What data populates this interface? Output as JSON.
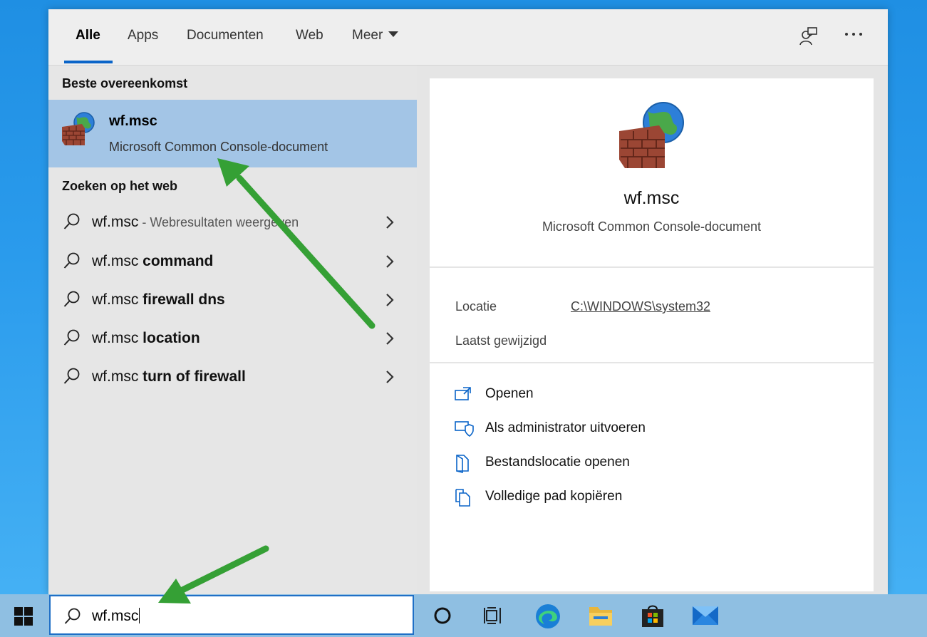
{
  "tabs": [
    {
      "label": "Alle",
      "active": true
    },
    {
      "label": "Apps"
    },
    {
      "label": "Documenten"
    },
    {
      "label": "Web"
    },
    {
      "label": "Meer"
    }
  ],
  "toolbar_icons": [
    "feedback-icon",
    "more-options-icon"
  ],
  "left": {
    "best_match_title": "Beste overeenkomst",
    "best_match": {
      "name": "wf.msc",
      "type": "Microsoft Common Console-document",
      "icon": "firewall-globe-icon"
    },
    "web_title": "Zoeken op het web",
    "web_results": [
      {
        "prefix": "wf.msc",
        "suffix": "",
        "note": " - Webresultaten weergeven"
      },
      {
        "prefix": "wf.msc ",
        "suffix": "command",
        "note": ""
      },
      {
        "prefix": "wf.msc ",
        "suffix": "firewall dns",
        "note": ""
      },
      {
        "prefix": "wf.msc ",
        "suffix": "location",
        "note": ""
      },
      {
        "prefix": "wf.msc ",
        "suffix": "turn of firewall",
        "note": ""
      }
    ]
  },
  "detail": {
    "name": "wf.msc",
    "type": "Microsoft Common Console-document",
    "location_label": "Locatie",
    "location_value": "C:\\WINDOWS\\system32",
    "modified_label": "Laatst gewijzigd",
    "actions": [
      {
        "label": "Openen",
        "icon": "open-icon"
      },
      {
        "label": "Als administrator uitvoeren",
        "icon": "admin-shield-icon"
      },
      {
        "label": "Bestandslocatie openen",
        "icon": "file-location-icon"
      },
      {
        "label": "Volledige pad kopiëren",
        "icon": "copy-icon"
      }
    ]
  },
  "search": {
    "value": "wf.msc"
  },
  "taskbar_apps": [
    "cortana-icon",
    "task-view-icon",
    "edge-icon",
    "file-explorer-icon",
    "store-icon",
    "mail-icon"
  ],
  "colors": {
    "accent": "#0a64c8",
    "selected_row": "#a3c5e6",
    "arrow": "#2e9b2e"
  }
}
